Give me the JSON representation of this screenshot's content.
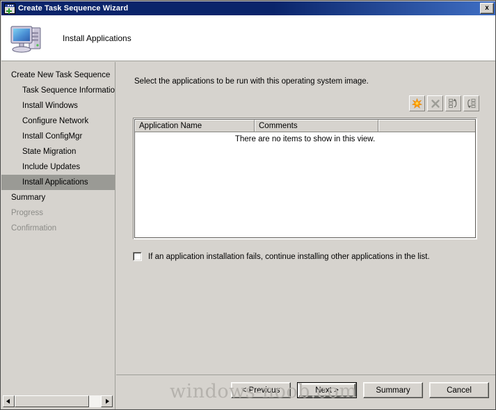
{
  "window": {
    "title": "Create Task Sequence Wizard",
    "close_label": "x",
    "icon": "wizard-window-icon"
  },
  "banner": {
    "title": "Install Applications",
    "icon": "computer-icon"
  },
  "sidebar": {
    "items": [
      {
        "label": "Create New Task Sequence",
        "level": 0,
        "state": "normal"
      },
      {
        "label": "Task Sequence Informatio",
        "level": 1,
        "state": "normal"
      },
      {
        "label": "Install Windows",
        "level": 1,
        "state": "normal"
      },
      {
        "label": "Configure Network",
        "level": 1,
        "state": "normal"
      },
      {
        "label": "Install ConfigMgr",
        "level": 1,
        "state": "normal"
      },
      {
        "label": "State Migration",
        "level": 1,
        "state": "normal"
      },
      {
        "label": "Include Updates",
        "level": 1,
        "state": "normal"
      },
      {
        "label": "Install Applications",
        "level": 1,
        "state": "selected"
      },
      {
        "label": "Summary",
        "level": 0,
        "state": "normal"
      },
      {
        "label": "Progress",
        "level": 0,
        "state": "disabled"
      },
      {
        "label": "Confirmation",
        "level": 0,
        "state": "disabled"
      }
    ],
    "scrollbar": {
      "left_arrow": "scroll-left-icon",
      "right_arrow": "scroll-right-icon"
    }
  },
  "main": {
    "instruction": "Select the applications to be run with this operating system image.",
    "toolbar": [
      {
        "name": "add-application-button",
        "icon": "starburst-new-icon",
        "enabled": true
      },
      {
        "name": "delete-application-button",
        "icon": "x-delete-icon",
        "enabled": false
      },
      {
        "name": "move-up-button",
        "icon": "move-up-icon",
        "enabled": false
      },
      {
        "name": "move-down-button",
        "icon": "move-down-icon",
        "enabled": false
      }
    ],
    "listview": {
      "columns": [
        "Application Name",
        "Comments",
        ""
      ],
      "rows": [],
      "empty_text": "There are no items to show in this view."
    },
    "continue_option": {
      "label": "If an application installation fails, continue installing other applications in the list.",
      "checked": false
    }
  },
  "footer": {
    "buttons": [
      {
        "label": "< Previous",
        "default": false
      },
      {
        "label": "Next >",
        "default": true
      },
      {
        "label": "Summary",
        "default": false
      },
      {
        "label": "Cancel",
        "default": false
      }
    ]
  },
  "watermark": {
    "text": "windows-noob.com"
  },
  "colors": {
    "titlebar_start": "#0a246a",
    "titlebar_end": "#3f6fc4",
    "window_face": "#d6d3ce",
    "selection": "#9a9a95",
    "accent_orange": "#ff9c00"
  }
}
